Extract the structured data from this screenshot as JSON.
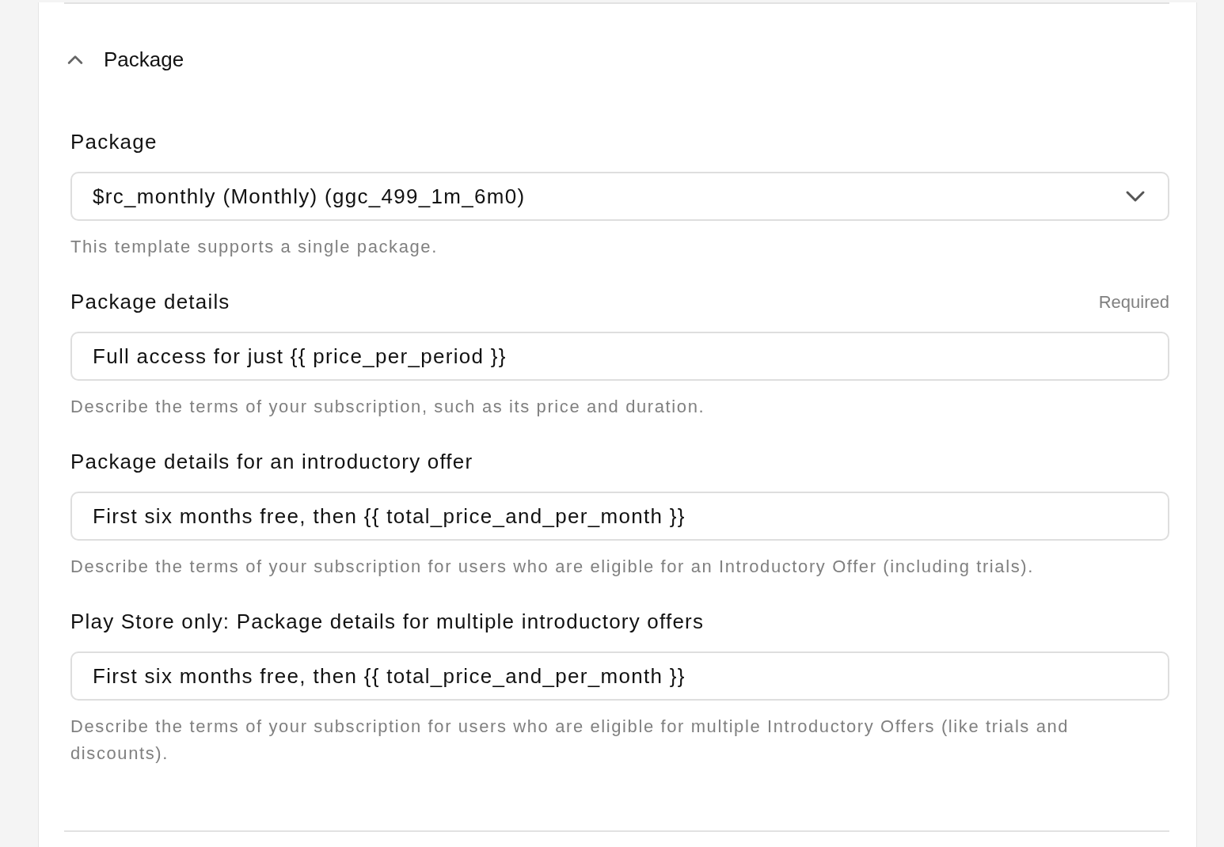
{
  "section": {
    "title": "Package",
    "expanded": true
  },
  "fields": [
    {
      "kind": "select",
      "label": "Package",
      "value": "$rc_monthly (Monthly) (ggc_499_1m_6m0)",
      "help": "This template supports a single package."
    },
    {
      "kind": "text",
      "label": "Package details",
      "required_label": "Required",
      "value": "Full access for just {{ price_per_period }}",
      "help": "Describe the terms of your subscription, such as its price and duration."
    },
    {
      "kind": "text",
      "label": "Package details for an introductory offer",
      "value": "First six months free, then {{ total_price_and_per_month }}",
      "help": "Describe the terms of your subscription for users who are eligible for an Introductory Offer (including trials)."
    },
    {
      "kind": "text",
      "label": "Play Store only: Package details for multiple introductory offers",
      "value": "First six months free, then {{ total_price_and_per_month }}",
      "help": "Describe the terms of your subscription for users who are eligible for multiple Introductory Offers (like trials and discounts)."
    }
  ]
}
